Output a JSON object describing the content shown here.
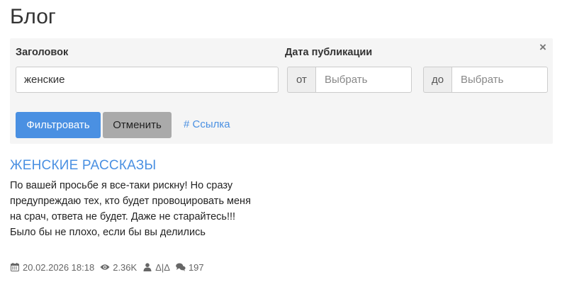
{
  "page": {
    "title": "Блог"
  },
  "filter": {
    "title_label": "Заголовок",
    "search_value": "женские",
    "date_label": "Дата публикации",
    "from_addon": "от",
    "from_placeholder": "Выбрать",
    "to_addon": "до",
    "to_placeholder": "Выбрать",
    "close_glyph": "×",
    "filter_button": "Фильтровать",
    "cancel_button": "Отменить",
    "link_button": "# Ссылка"
  },
  "post": {
    "title": "ЖЕНСКИЕ РАССКАЗЫ",
    "excerpt_lines": [
      "По вашей просьбе я все-таки рискну! Но сразу",
      "предупреждаю тех, кто будет провоцировать  меня",
      "на срач, ответа не будет.  Даже не старайтесь!!!",
      "Было бы не плохо, если бы вы  делились"
    ],
    "date": "20.02.2026 18:18",
    "views": "2.36K",
    "author": "Δ|Δ",
    "comments": "197"
  },
  "colors": {
    "accent": "#4a90e2",
    "panel_bg": "#f5f5f5",
    "cancel_bg": "#aaaaaa",
    "meta_text": "#666666"
  },
  "icons": {
    "close": "close-icon",
    "date": "calendar-icon",
    "views": "eye-icon",
    "author": "user-icon",
    "comments": "comments-icon"
  }
}
